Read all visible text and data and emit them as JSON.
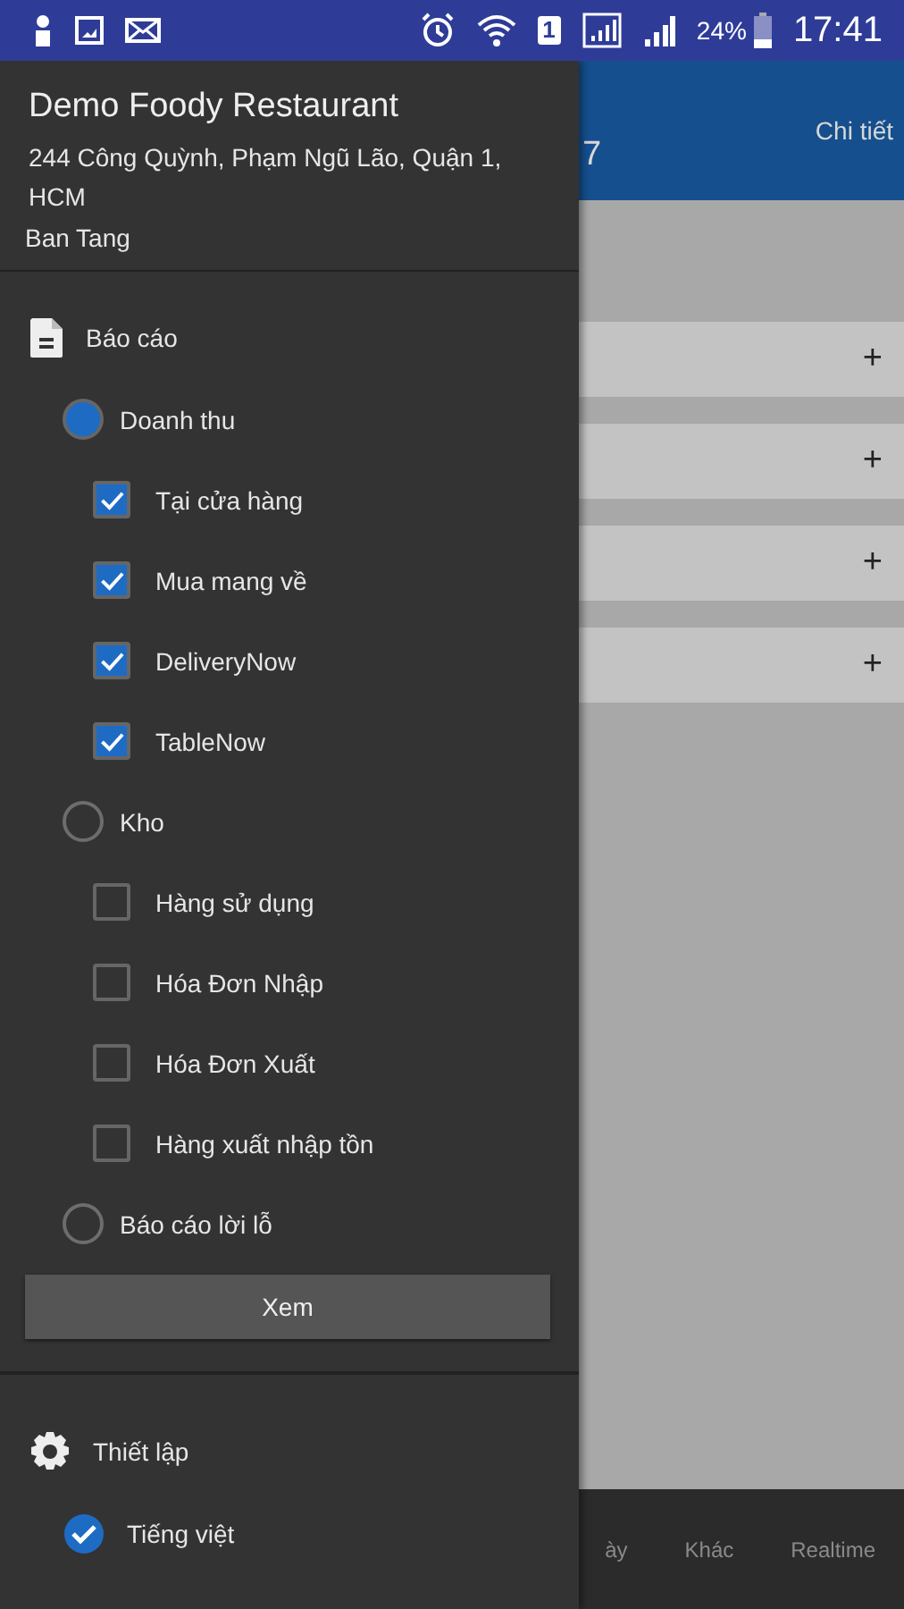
{
  "status_bar": {
    "sim_slot": "1",
    "battery": "24%",
    "time": "17:41"
  },
  "background_app": {
    "header": {
      "title_fragment": "7",
      "action": "Chi tiết"
    },
    "rows": [
      {
        "action": "+"
      },
      {
        "action": "+"
      },
      {
        "action": "+"
      },
      {
        "action": "+"
      }
    ],
    "bottom_nav": [
      {
        "label": "ày"
      },
      {
        "label": "Khác"
      },
      {
        "label": "Realtime"
      }
    ]
  },
  "drawer": {
    "header": {
      "name": "Demo Foody Restaurant",
      "address": "244 Công Quỳnh, Phạm Ngũ Lão, Quận 1, HCM",
      "user": "Ban Tang"
    },
    "report": {
      "title": "Báo cáo",
      "options": [
        {
          "label": "Doanh thu",
          "selected": true,
          "children": [
            {
              "label": "Tại cửa hàng",
              "checked": true
            },
            {
              "label": "Mua mang về",
              "checked": true
            },
            {
              "label": "DeliveryNow",
              "checked": true
            },
            {
              "label": "TableNow",
              "checked": true
            }
          ]
        },
        {
          "label": "Kho",
          "selected": false,
          "children": [
            {
              "label": "Hàng sử dụng",
              "checked": false
            },
            {
              "label": "Hóa Đơn Nhập",
              "checked": false
            },
            {
              "label": "Hóa Đơn Xuất",
              "checked": false
            },
            {
              "label": "Hàng xuất nhập tồn",
              "checked": false
            }
          ]
        },
        {
          "label": "Báo cáo lời lỗ",
          "selected": false
        }
      ],
      "button": "Xem"
    },
    "settings": {
      "title": "Thiết lập",
      "items": [
        {
          "label": "Tiếng việt",
          "checked": true
        }
      ]
    }
  }
}
